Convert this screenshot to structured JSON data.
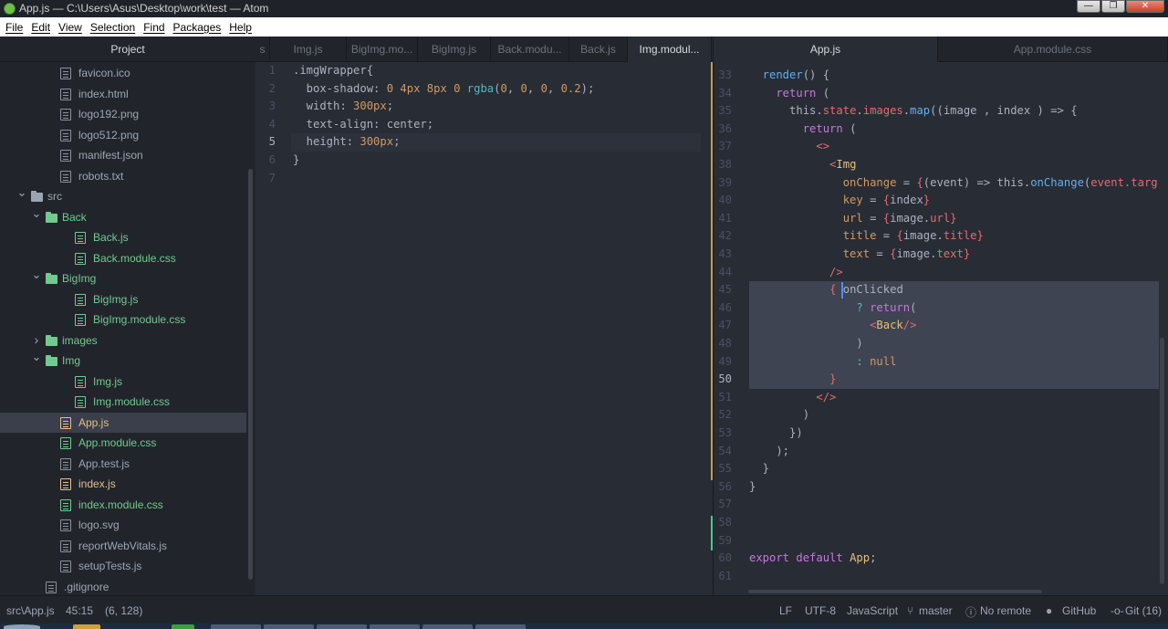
{
  "window": {
    "title": "App.js — C:\\Users\\Asus\\Desktop\\work\\test — Atom",
    "buttons": [
      "—",
      "❐",
      "✕"
    ]
  },
  "menu": [
    "File",
    "Edit",
    "View",
    "Selection",
    "Find",
    "Packages",
    "Help"
  ],
  "tree": {
    "header": "Project",
    "items": [
      {
        "label": "favicon.ico",
        "kind": "file",
        "depth": 2,
        "color": "default"
      },
      {
        "label": "index.html",
        "kind": "file",
        "depth": 2,
        "color": "default"
      },
      {
        "label": "logo192.png",
        "kind": "file",
        "depth": 2,
        "color": "default"
      },
      {
        "label": "logo512.png",
        "kind": "file",
        "depth": 2,
        "color": "default"
      },
      {
        "label": "manifest.json",
        "kind": "file",
        "depth": 2,
        "color": "default"
      },
      {
        "label": "robots.txt",
        "kind": "file",
        "depth": 2,
        "color": "default"
      },
      {
        "label": "src",
        "kind": "folder",
        "depth": 1,
        "color": "default",
        "open": true
      },
      {
        "label": "Back",
        "kind": "folder",
        "depth": 2,
        "color": "green",
        "open": true
      },
      {
        "label": "Back.js",
        "kind": "file",
        "depth": 3,
        "color": "green"
      },
      {
        "label": "Back.module.css",
        "kind": "file",
        "depth": 3,
        "color": "green"
      },
      {
        "label": "BigImg",
        "kind": "folder",
        "depth": 2,
        "color": "green",
        "open": true
      },
      {
        "label": "BigImg.js",
        "kind": "file",
        "depth": 3,
        "color": "green"
      },
      {
        "label": "BigImg.module.css",
        "kind": "file",
        "depth": 3,
        "color": "green"
      },
      {
        "label": "images",
        "kind": "folder",
        "depth": 2,
        "color": "green",
        "open": false
      },
      {
        "label": "Img",
        "kind": "folder",
        "depth": 2,
        "color": "green",
        "open": true
      },
      {
        "label": "Img.js",
        "kind": "file",
        "depth": 3,
        "color": "green"
      },
      {
        "label": "Img.module.css",
        "kind": "file",
        "depth": 3,
        "color": "green"
      },
      {
        "label": "App.js",
        "kind": "file",
        "depth": 2,
        "color": "yellow",
        "selected": true
      },
      {
        "label": "App.module.css",
        "kind": "file",
        "depth": 2,
        "color": "green"
      },
      {
        "label": "App.test.js",
        "kind": "file",
        "depth": 2,
        "color": "default"
      },
      {
        "label": "index.js",
        "kind": "file",
        "depth": 2,
        "color": "yellow"
      },
      {
        "label": "index.module.css",
        "kind": "file",
        "depth": 2,
        "color": "green"
      },
      {
        "label": "logo.svg",
        "kind": "file",
        "depth": 2,
        "color": "default"
      },
      {
        "label": "reportWebVitals.js",
        "kind": "file",
        "depth": 2,
        "color": "default"
      },
      {
        "label": "setupTests.js",
        "kind": "file",
        "depth": 2,
        "color": "default"
      },
      {
        "label": ".gitignore",
        "kind": "file",
        "depth": 1,
        "color": "default"
      }
    ]
  },
  "left_pane": {
    "tabs": [
      {
        "label": "s",
        "active": false
      },
      {
        "label": "Img.js",
        "active": false
      },
      {
        "label": "BigImg.mo...",
        "active": false
      },
      {
        "label": "BigImg.js",
        "active": false
      },
      {
        "label": "Back.modu...",
        "active": false
      },
      {
        "label": "Back.js",
        "active": false
      },
      {
        "label": "Img.modul...",
        "active": true
      }
    ],
    "lines": [
      {
        "n": "1",
        "tokens": [
          [
            "p",
            ".imgWrapper{"
          ]
        ]
      },
      {
        "n": "2",
        "tokens": [
          [
            "p",
            "  box-shadow: "
          ],
          [
            "n",
            "0 4px 8px 0 "
          ],
          [
            "c",
            "rgba"
          ],
          [
            "p",
            "("
          ],
          [
            "n",
            "0"
          ],
          [
            "p",
            ", "
          ],
          [
            "n",
            "0"
          ],
          [
            "p",
            ", "
          ],
          [
            "n",
            "0"
          ],
          [
            "p",
            ", "
          ],
          [
            "n",
            "0.2"
          ],
          [
            "p",
            ");"
          ]
        ]
      },
      {
        "n": "3",
        "tokens": [
          [
            "p",
            "  width: "
          ],
          [
            "n",
            "300px"
          ],
          [
            "p",
            ";"
          ]
        ]
      },
      {
        "n": "4",
        "tokens": [
          [
            "p",
            "  text-align: center;"
          ]
        ]
      },
      {
        "n": "5",
        "tokens": [
          [
            "p",
            "  height: "
          ],
          [
            "n",
            "300px"
          ],
          [
            "p",
            ";"
          ]
        ],
        "current": true
      },
      {
        "n": "6",
        "tokens": [
          [
            "p",
            "}"
          ]
        ]
      },
      {
        "n": "7",
        "tokens": []
      }
    ]
  },
  "right_pane": {
    "tabs": [
      {
        "label": "App.js",
        "active": true
      },
      {
        "label": "App.module.css",
        "active": false
      }
    ],
    "lines": [
      {
        "n": "33",
        "tokens": [
          [
            "f",
            "  render"
          ],
          [
            "p",
            "() {"
          ]
        ]
      },
      {
        "n": "34",
        "tokens": [
          [
            "k",
            "    return"
          ],
          [
            "p",
            " ("
          ]
        ]
      },
      {
        "n": "35",
        "tokens": [
          [
            "p",
            "      this."
          ],
          [
            "t",
            "state"
          ],
          [
            "p",
            "."
          ],
          [
            "t",
            "images"
          ],
          [
            "p",
            "."
          ],
          [
            "f",
            "map"
          ],
          [
            "p",
            "((image , index ) => {"
          ]
        ]
      },
      {
        "n": "36",
        "tokens": [
          [
            "k",
            "        return"
          ],
          [
            "p",
            " ("
          ]
        ]
      },
      {
        "n": "37",
        "tokens": [
          [
            "p",
            "          "
          ],
          [
            "t",
            "<>"
          ]
        ]
      },
      {
        "n": "38",
        "tokens": [
          [
            "p",
            "            "
          ],
          [
            "t",
            "<"
          ],
          [
            "y",
            "Img"
          ]
        ]
      },
      {
        "n": "39",
        "tokens": [
          [
            "a",
            "              onChange"
          ],
          [
            "p",
            " = "
          ],
          [
            "t",
            "{"
          ],
          [
            "p",
            "(event) => this."
          ],
          [
            "f",
            "onChange"
          ],
          [
            "p",
            "("
          ],
          [
            "t",
            "event.targ"
          ]
        ]
      },
      {
        "n": "40",
        "tokens": [
          [
            "a",
            "              key"
          ],
          [
            "p",
            " = "
          ],
          [
            "t",
            "{"
          ],
          [
            "p",
            "index"
          ],
          [
            "t",
            "}"
          ]
        ]
      },
      {
        "n": "41",
        "tokens": [
          [
            "a",
            "              url"
          ],
          [
            "p",
            " = "
          ],
          [
            "t",
            "{"
          ],
          [
            "p",
            "image."
          ],
          [
            "t",
            "url"
          ],
          [
            "t",
            "}"
          ]
        ]
      },
      {
        "n": "42",
        "tokens": [
          [
            "a",
            "              title"
          ],
          [
            "p",
            " = "
          ],
          [
            "t",
            "{"
          ],
          [
            "p",
            "image."
          ],
          [
            "t",
            "title"
          ],
          [
            "t",
            "}"
          ]
        ]
      },
      {
        "n": "43",
        "tokens": [
          [
            "a",
            "              text"
          ],
          [
            "p",
            " = "
          ],
          [
            "t",
            "{"
          ],
          [
            "p",
            "image."
          ],
          [
            "t",
            "text"
          ],
          [
            "t",
            "}"
          ]
        ]
      },
      {
        "n": "44",
        "tokens": [
          [
            "t",
            "            />"
          ]
        ]
      },
      {
        "n": "45",
        "tokens": [
          [
            "p",
            "            "
          ],
          [
            "t",
            "{"
          ],
          [
            "p",
            " onClicked"
          ]
        ],
        "selected": true
      },
      {
        "n": "46",
        "tokens": [
          [
            "p",
            "                "
          ],
          [
            "c",
            "?"
          ],
          [
            "k",
            " return"
          ],
          [
            "p",
            "("
          ]
        ],
        "selected": true
      },
      {
        "n": "47",
        "tokens": [
          [
            "p",
            "                  "
          ],
          [
            "t",
            "<"
          ],
          [
            "y",
            "Back"
          ],
          [
            "t",
            "/>"
          ]
        ],
        "selected": true
      },
      {
        "n": "48",
        "tokens": [
          [
            "p",
            "                )"
          ]
        ],
        "selected": true
      },
      {
        "n": "49",
        "tokens": [
          [
            "p",
            "                "
          ],
          [
            "c",
            ":"
          ],
          [
            "n",
            " null"
          ]
        ],
        "selected": true
      },
      {
        "n": "50",
        "tokens": [
          [
            "p",
            "            "
          ],
          [
            "t",
            "}"
          ]
        ],
        "selected": true,
        "current": true
      },
      {
        "n": "51",
        "tokens": [
          [
            "t",
            "          </>"
          ]
        ]
      },
      {
        "n": "52",
        "tokens": [
          [
            "p",
            "        )"
          ]
        ]
      },
      {
        "n": "53",
        "tokens": [
          [
            "p",
            "      })"
          ]
        ]
      },
      {
        "n": "54",
        "tokens": [
          [
            "p",
            "    );"
          ]
        ]
      },
      {
        "n": "55",
        "tokens": [
          [
            "p",
            "  }"
          ]
        ]
      },
      {
        "n": "56",
        "tokens": [
          [
            "p",
            "}"
          ]
        ]
      },
      {
        "n": "57",
        "tokens": []
      },
      {
        "n": "58",
        "tokens": []
      },
      {
        "n": "59",
        "tokens": []
      },
      {
        "n": "60",
        "tokens": [
          [
            "k",
            "export"
          ],
          [
            "k",
            " default"
          ],
          [
            "p",
            " "
          ],
          [
            "y",
            "App"
          ],
          [
            "p",
            ";"
          ]
        ]
      },
      {
        "n": "61",
        "tokens": []
      }
    ]
  },
  "status": {
    "file": "src\\App.js",
    "cursor": "45:15",
    "selection": "(6, 128)",
    "line_ending": "LF",
    "encoding": "UTF-8",
    "grammar": "JavaScript",
    "branch": "master",
    "remote": "No remote",
    "github": "GitHub",
    "git": "Git (16)"
  },
  "colors": {
    "bg": "#282c34",
    "panel": "#21252b",
    "green": "#73c990",
    "yellow": "#e2c08d",
    "selection": "#3e4451",
    "cursor": "#528bff"
  }
}
